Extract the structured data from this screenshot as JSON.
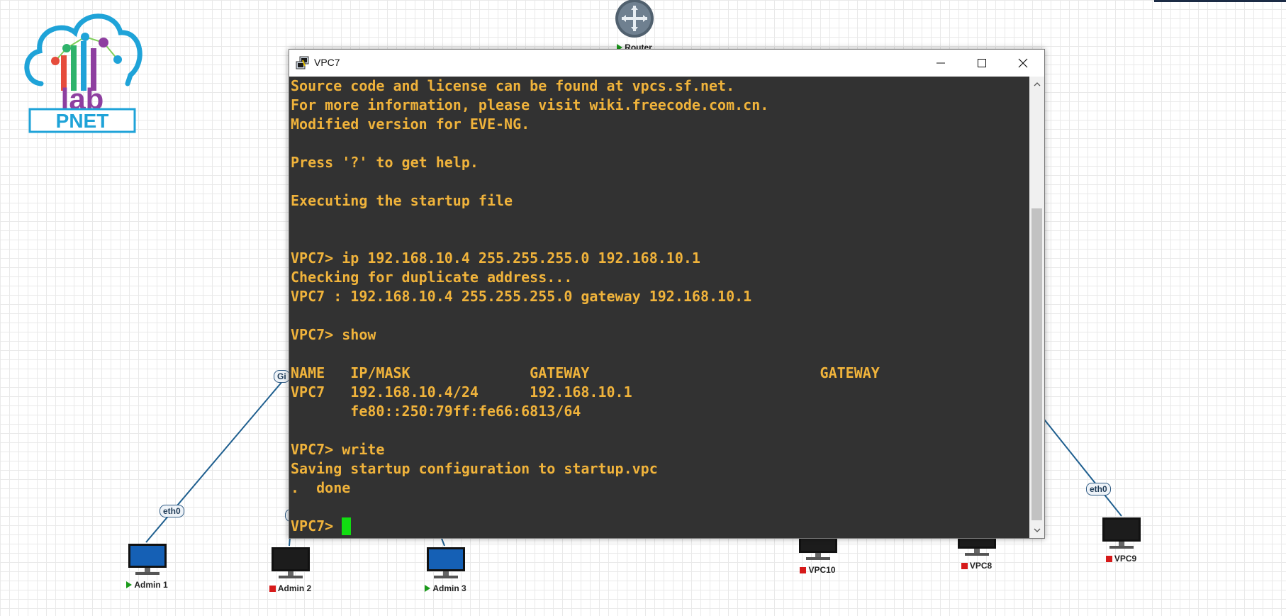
{
  "canvas": {
    "nodes": {
      "router": "Router",
      "admin1": "Admin 1",
      "admin2": "Admin 2",
      "admin3": "Admin 3",
      "vpc10": "VPC10",
      "vpc8": "VPC8",
      "vpc9": "VPC9"
    },
    "interfaces": {
      "admin1_eth": "eth0",
      "vpc9_eth": "eth0",
      "switch_gi_left": "Gi",
      "switch_gi_admin2": "Gi"
    },
    "logo": {
      "line1": "lab",
      "line2": "PNET"
    }
  },
  "window": {
    "title": "VPC7",
    "minimize": "—",
    "maximize": "□",
    "close": "✕"
  },
  "terminal": {
    "lines": [
      "Source code and license can be found at vpcs.sf.net.",
      "For more information, please visit wiki.freecode.com.cn.",
      "Modified version for EVE-NG.",
      "",
      "Press '?' to get help.",
      "",
      "Executing the startup file",
      "",
      "",
      "VPC7> ip 192.168.10.4 255.255.255.0 192.168.10.1",
      "Checking for duplicate address...",
      "VPC7 : 192.168.10.4 255.255.255.0 gateway 192.168.10.1",
      "",
      "VPC7> show",
      "",
      "NAME   IP/MASK              GATEWAY                           GATEWAY",
      "VPC7   192.168.10.4/24      192.168.10.1",
      "       fe80::250:79ff:fe66:6813/64",
      "",
      "VPC7> write",
      "Saving startup configuration to startup.vpc",
      ".  done",
      ""
    ],
    "prompt": "VPC7> "
  },
  "colors": {
    "terminal_bg": "#323232",
    "terminal_fg": "#f0b33b",
    "cursor": "#11dd11",
    "link": "#1f5f8f",
    "running": "#1a9a1a",
    "stopped": "#d61a1a"
  }
}
